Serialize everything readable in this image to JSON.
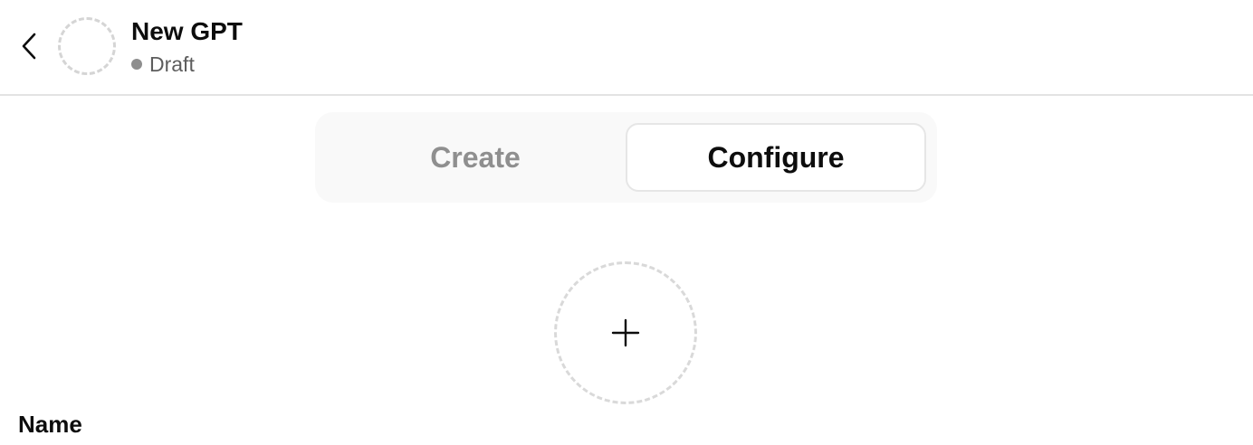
{
  "header": {
    "title": "New GPT",
    "status": "Draft",
    "back_icon": "chevron-left-icon"
  },
  "tabs": [
    {
      "label": "Create",
      "active": false
    },
    {
      "label": "Configure",
      "active": true
    }
  ],
  "avatar_upload": {
    "icon": "plus-icon"
  },
  "form": {
    "name_label": "Name"
  },
  "colors": {
    "text": "#0d0d0d",
    "muted": "#8f8f8f",
    "dashed_border": "#d9d9d9",
    "tab_bg": "#f9f9f9",
    "status_dot": "#8e8e8e"
  }
}
